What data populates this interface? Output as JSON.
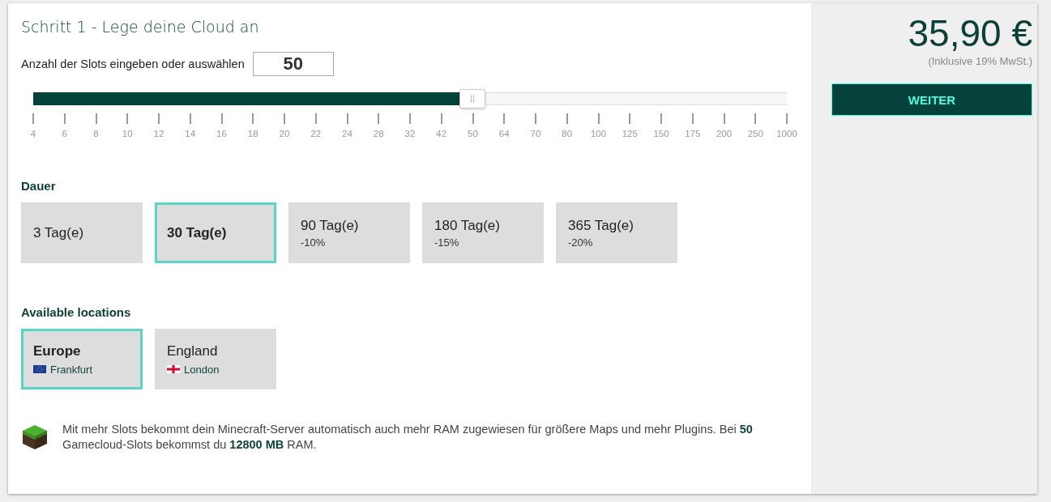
{
  "step_title": "Schritt 1 - Lege deine Cloud an",
  "slots": {
    "label": "Anzahl der Slots eingeben oder auswählen",
    "value": "50",
    "level": 0.583,
    "ticks": [
      "4",
      "6",
      "8",
      "10",
      "12",
      "14",
      "16",
      "18",
      "20",
      "22",
      "24",
      "28",
      "32",
      "42",
      "50",
      "64",
      "70",
      "80",
      "100",
      "125",
      "150",
      "175",
      "200",
      "250",
      "1000"
    ]
  },
  "duration": {
    "heading": "Dauer",
    "options": [
      {
        "label": "3 Tag(e)",
        "selected": false
      },
      {
        "label": "30 Tag(e)",
        "selected": true
      },
      {
        "label": "90 Tag(e)",
        "discount": "-10%",
        "selected": false
      },
      {
        "label": "180 Tag(e)",
        "discount": "-15%",
        "selected": false
      },
      {
        "label": "365 Tag(e)",
        "discount": "-20%",
        "selected": false
      }
    ]
  },
  "locations": {
    "heading": "Available locations",
    "options": [
      {
        "region": "Europe",
        "city": "Frankfurt",
        "kind": "eu",
        "selected": true
      },
      {
        "region": "England",
        "city": "London",
        "kind": "england",
        "selected": false
      }
    ]
  },
  "info": "Mit mehr Slots bekommt dein Minecraft-Server automatisch auch mehr RAM zugewiesen für größere Maps und mehr Plugins. Bei **50** Gamecloud-Slots bekommst du **12800 MB** RAM.",
  "summary": {
    "price": "35,90 €",
    "tax_note": "(Inklusive 19% MwSt.)",
    "button": "WEITER"
  }
}
